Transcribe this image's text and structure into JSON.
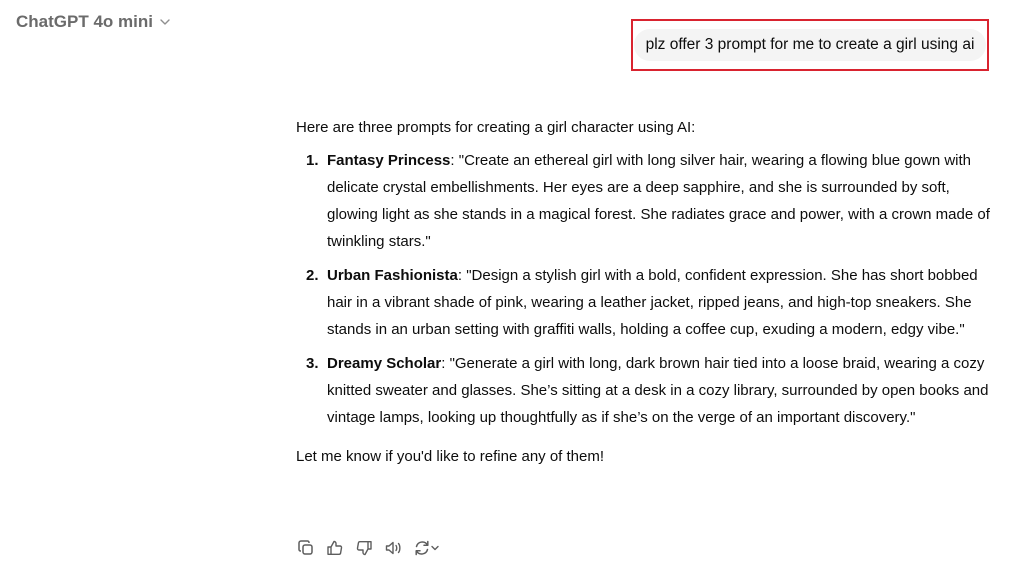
{
  "header": {
    "model_name": "ChatGPT 4o mini",
    "model_chevron_icon": "chevron-down-icon"
  },
  "user_message": {
    "text": "plz offer 3 prompt for me to create a girl using ai",
    "highlight_color": "#d9232f"
  },
  "assistant_message": {
    "intro": "Here are three prompts for creating a girl character using AI:",
    "prompts": [
      {
        "number": "1.",
        "title": "Fantasy Princess",
        "text": ": \"Create an ethereal girl with long silver hair, wearing a flowing blue gown with delicate crystal embellishments. Her eyes are a deep sapphire, and she is surrounded by soft, glowing light as she stands in a magical forest. She radiates grace and power, with a crown made of twinkling stars.\""
      },
      {
        "number": "2.",
        "title": "Urban Fashionista",
        "text": ": \"Design a stylish girl with a bold, confident expression. She has short bobbed hair in a vibrant shade of pink, wearing a leather jacket, ripped jeans, and high-top sneakers. She stands in an urban setting with graffiti walls, holding a coffee cup, exuding a modern, edgy vibe.\""
      },
      {
        "number": "3.",
        "title": "Dreamy Scholar",
        "text": ": \"Generate a girl with long, dark brown hair tied into a loose braid, wearing a cozy knitted sweater and glasses. She’s sitting at a desk in a cozy library, surrounded by open books and vintage lamps, looking up thoughtfully as if she’s on the verge of an important discovery.\""
      }
    ],
    "outro": "Let me know if you'd like to refine any of them!"
  },
  "actions": [
    {
      "icon": "copy-icon"
    },
    {
      "icon": "thumbs-up-icon"
    },
    {
      "icon": "thumbs-down-icon"
    },
    {
      "icon": "read-aloud-icon"
    },
    {
      "icon": "regenerate-icon"
    }
  ],
  "colors": {
    "text": "#0d0d0d",
    "muted": "#6b6b6b",
    "bubble": "#f4f4f4"
  }
}
